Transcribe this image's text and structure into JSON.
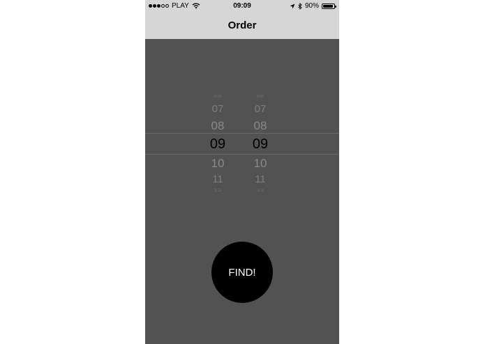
{
  "status_bar": {
    "carrier": "PLAY",
    "time": "09:09",
    "battery_percent": "90%",
    "battery_level": 0.9,
    "signal_bars_filled": 3,
    "signal_bars_total": 5
  },
  "nav": {
    "title": "Order"
  },
  "picker": {
    "hours": [
      "06",
      "07",
      "08",
      "09",
      "10",
      "11",
      "12"
    ],
    "minutes": [
      "06",
      "07",
      "08",
      "09",
      "10",
      "11",
      "12"
    ],
    "selected_hour": "09",
    "selected_minute": "09"
  },
  "actions": {
    "find_label": "FIND!"
  },
  "colors": {
    "top_bar": "#d6d6d6",
    "background": "#525252",
    "button": "#000000",
    "button_text": "#ffffff"
  }
}
